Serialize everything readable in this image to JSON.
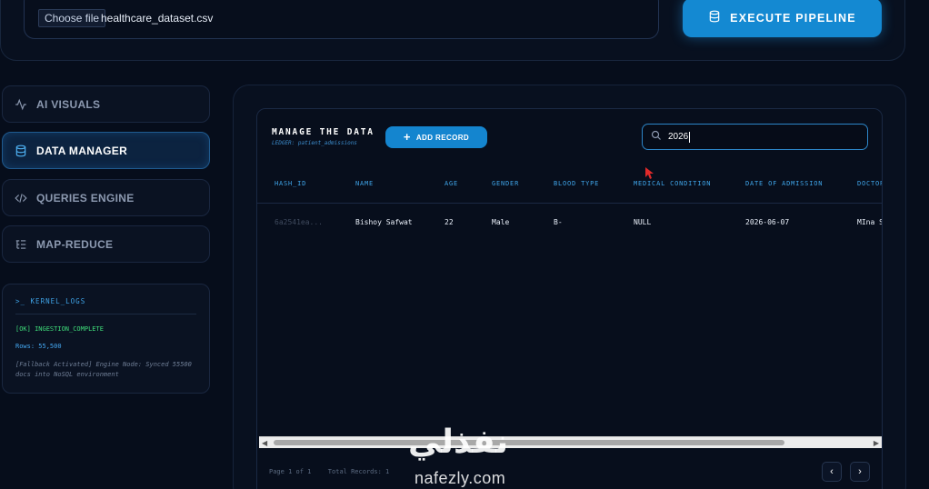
{
  "upload": {
    "choose_file_label": "Choose file",
    "file_name": "healthcare_dataset.csv",
    "execute_label": "EXECUTE PIPELINE"
  },
  "sidebar": {
    "items": [
      {
        "label": "AI VISUALS",
        "icon": "activity-icon",
        "active": false
      },
      {
        "label": "DATA MANAGER",
        "icon": "database-icon",
        "active": true
      },
      {
        "label": "QUERIES ENGINE",
        "icon": "code-icon",
        "active": false
      },
      {
        "label": "MAP-REDUCE",
        "icon": "list-tree-icon",
        "active": false
      }
    ]
  },
  "logs": {
    "title": ">_ KERNEL_LOGS",
    "lines": {
      "ok": "[OK] INGESTION_COMPLETE",
      "rows": "Rows: 55,500",
      "fallback": "[Fallback Activated] Engine Node: Synced 55500 docs into NoSQL environment"
    }
  },
  "manager": {
    "title": "MANAGE THE DATA",
    "subtitle": "LEDGER: patient_admissions",
    "add_label": "ADD RECORD",
    "search_value": "2026",
    "columns": [
      "HASH_ID",
      "NAME",
      "AGE",
      "GENDER",
      "BLOOD TYPE",
      "MEDICAL CONDITION",
      "DATE OF ADMISSION",
      "DOCTOR"
    ],
    "rows": [
      [
        "6a2541ea...",
        "Bishoy Safwat",
        "22",
        "Male",
        "B-",
        "NULL",
        "2026-06-07",
        "MIna S"
      ]
    ],
    "pager": {
      "page_info": "Page 1 of 1",
      "total_records": "Total Records: 1"
    }
  },
  "watermark": {
    "arabic": "نفذلي",
    "domain": "nafezly.com"
  },
  "colors": {
    "accent": "#1489d2",
    "background": "#060d1b",
    "ok": "#3fdc7a"
  }
}
